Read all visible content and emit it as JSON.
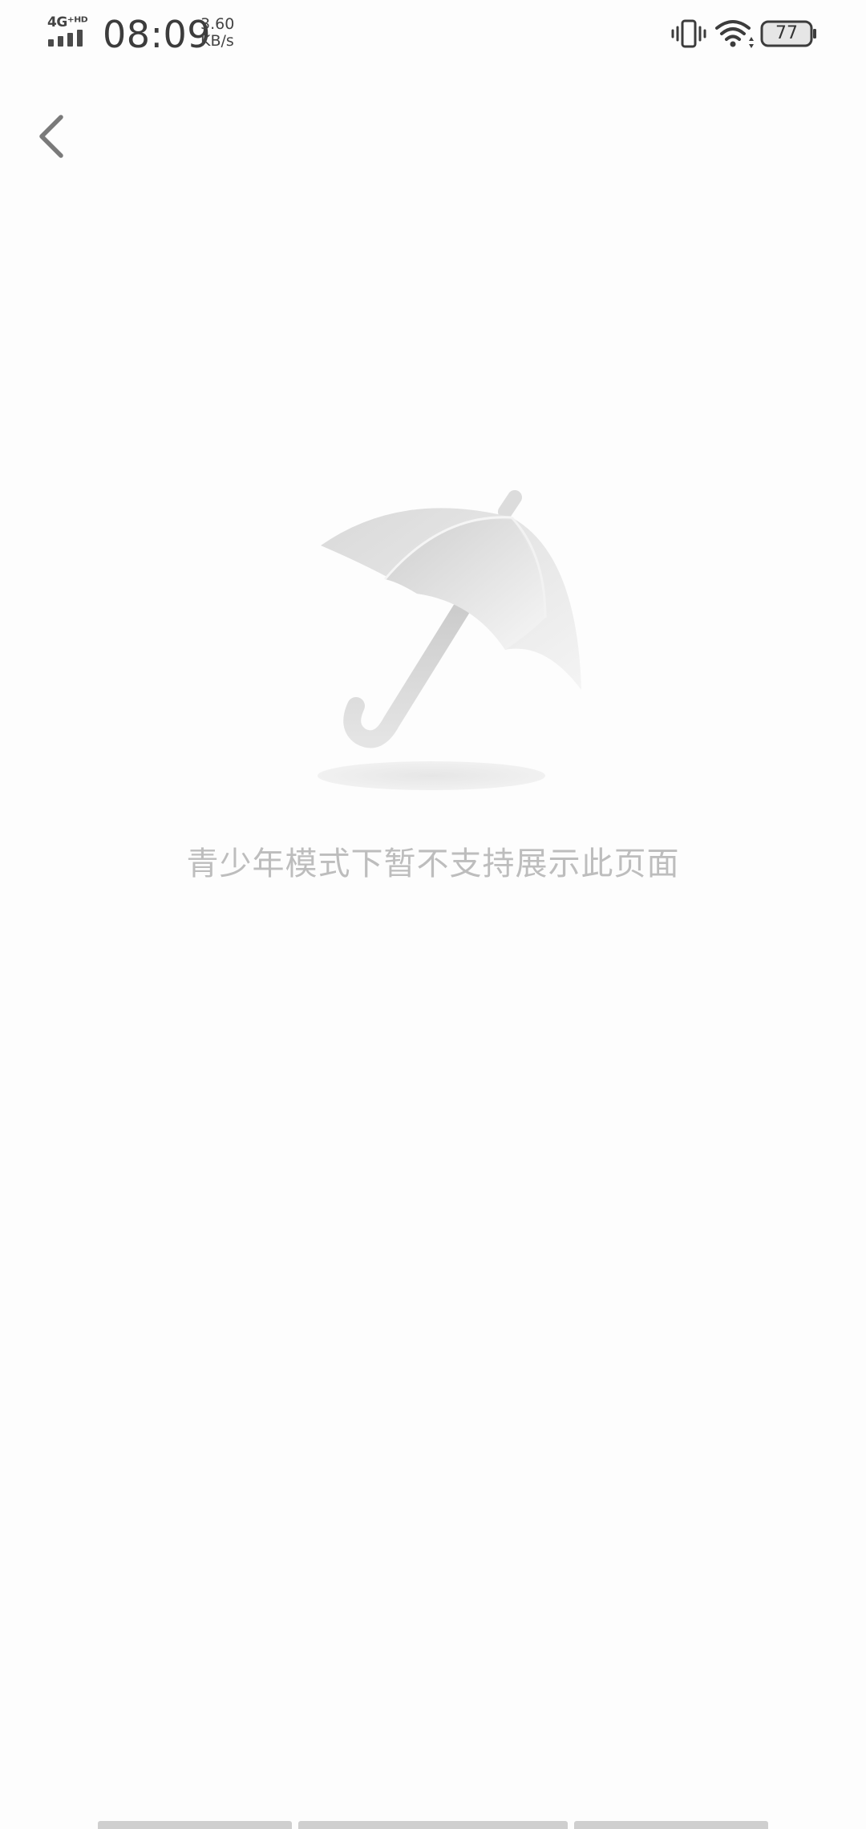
{
  "status_bar": {
    "network_type": "4G⁺ᴴᴰ",
    "time": "08:09",
    "speed_value": "3.60",
    "speed_unit": "KB/s",
    "battery_level": "77",
    "icons": [
      "signal-icon",
      "vibrate-icon",
      "wifi-icon",
      "battery-icon"
    ]
  },
  "navigation": {
    "back_icon": "chevron-left-icon"
  },
  "empty_state": {
    "illustration": "umbrella-icon",
    "message": "青少年模式下暂不支持展示此页面"
  },
  "colors": {
    "background": "#fdfdfd",
    "message_text": "#bdbdbd",
    "back_icon": "#7a7a7a"
  }
}
